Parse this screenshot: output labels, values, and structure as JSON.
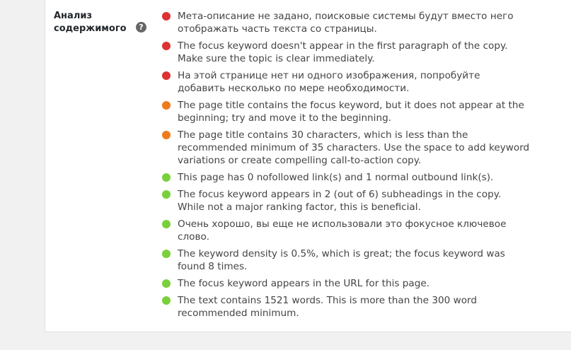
{
  "section": {
    "label_line1": "Анализ",
    "label_line2": "содержимого",
    "help_icon": "question-mark-icon",
    "help_glyph": "?"
  },
  "colors": {
    "bad": "#dc3232",
    "ok": "#ee7c1b",
    "good": "#7ad03a"
  },
  "results": [
    {
      "status": "bad",
      "text": "Мета-описание не задано, поисковые системы будут вместо него отображать часть текста со страницы."
    },
    {
      "status": "bad",
      "text": "The focus keyword doesn't appear in the first paragraph of the copy. Make sure the topic is clear immediately."
    },
    {
      "status": "bad",
      "text": "На этой странице нет ни одного изображения, попробуйте добавить несколько по мере необходимости."
    },
    {
      "status": "ok",
      "text": "The page title contains the focus keyword, but it does not appear at the beginning; try and move it to the beginning."
    },
    {
      "status": "ok",
      "text": "The page title contains 30 characters, which is less than the recommended minimum of 35 characters. Use the space to add keyword variations or create compelling call-to-action copy."
    },
    {
      "status": "good",
      "text": "This page has 0 nofollowed link(s) and 1 normal outbound link(s)."
    },
    {
      "status": "good",
      "text": "The focus keyword appears in 2 (out of 6) subheadings in the copy. While not a major ranking factor, this is beneficial."
    },
    {
      "status": "good",
      "text": "Очень хорошо, вы еще не использовали это фокусное ключевое слово."
    },
    {
      "status": "good",
      "text": "The keyword density is 0.5%, which is great; the focus keyword was found 8 times."
    },
    {
      "status": "good",
      "text": "The focus keyword appears in the URL for this page."
    },
    {
      "status": "good",
      "text": "The text contains 1521 words. This is more than the 300 word recommended minimum."
    }
  ]
}
